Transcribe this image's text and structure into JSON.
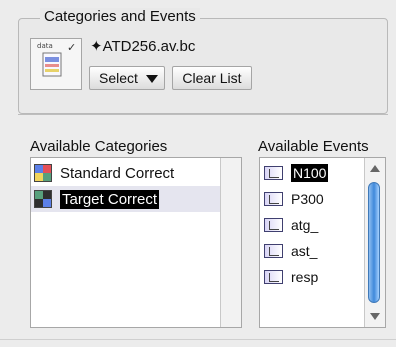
{
  "window": {
    "group_title": "Categories and Events",
    "thumb_label": "data",
    "thumb_mark": "✓",
    "file_path": "✦ATD256.av.bc"
  },
  "controls": {
    "select_label": "Select",
    "clear_label": "Clear List"
  },
  "categories": {
    "title": "Available Categories",
    "items": [
      {
        "label": "Standard Correct",
        "selected": false,
        "icon": "color-grid-icon"
      },
      {
        "label": "Target Correct",
        "selected": true,
        "icon": "color-grid-icon"
      }
    ]
  },
  "events": {
    "title": "Available Events",
    "items": [
      {
        "label": "N100",
        "selected": true,
        "icon": "event-icon"
      },
      {
        "label": "P300",
        "selected": false,
        "icon": "event-icon"
      },
      {
        "label": "atg_",
        "selected": false,
        "icon": "event-icon"
      },
      {
        "label": "ast_",
        "selected": false,
        "icon": "event-icon"
      },
      {
        "label": "resp",
        "selected": false,
        "icon": "event-icon"
      }
    ]
  },
  "colors": {
    "selection_background": "#e5e5ef",
    "selected_text_background": "#000000",
    "scroll_thumb": "#3f89db",
    "icon_red": "#e55058",
    "icon_green": "#58a07d",
    "icon_yellow": "#f2d55c",
    "icon_blue": "#5c80e8",
    "icon_dark": "#2f2f2f"
  }
}
